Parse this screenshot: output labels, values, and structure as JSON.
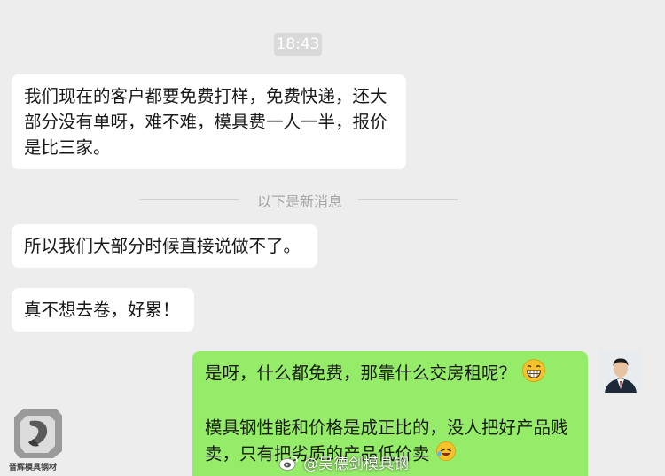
{
  "chat": {
    "timestamp": "18:43",
    "new_messages_divider": "以下是新消息",
    "messages": [
      {
        "side": "in",
        "text": "我们现在的客户都要免费打样，免费快递，还大部分没有单呀，难不难，模具费一人一半，报价是比三家。"
      },
      {
        "side": "in",
        "text": "所以我们大部分时候直接说做不了。"
      },
      {
        "side": "in",
        "text": "真不想去卷，好累！"
      },
      {
        "side": "out",
        "line1": "是呀，什么都免费，那靠什么交房租呢？",
        "emoji1": "grinning-face",
        "line2": "模具钢性能和价格是成正比的，没人把好产品贱卖，只有把劣质的产品低价卖",
        "emoji2": "laughing-face"
      }
    ]
  },
  "logo": {
    "text": "晋辉模具钢材"
  },
  "watermark": {
    "text": "@吴德剑模具钢"
  },
  "colors": {
    "outgoing_bubble": "#95ec69",
    "incoming_bubble": "#ffffff",
    "background": "#ededed"
  }
}
